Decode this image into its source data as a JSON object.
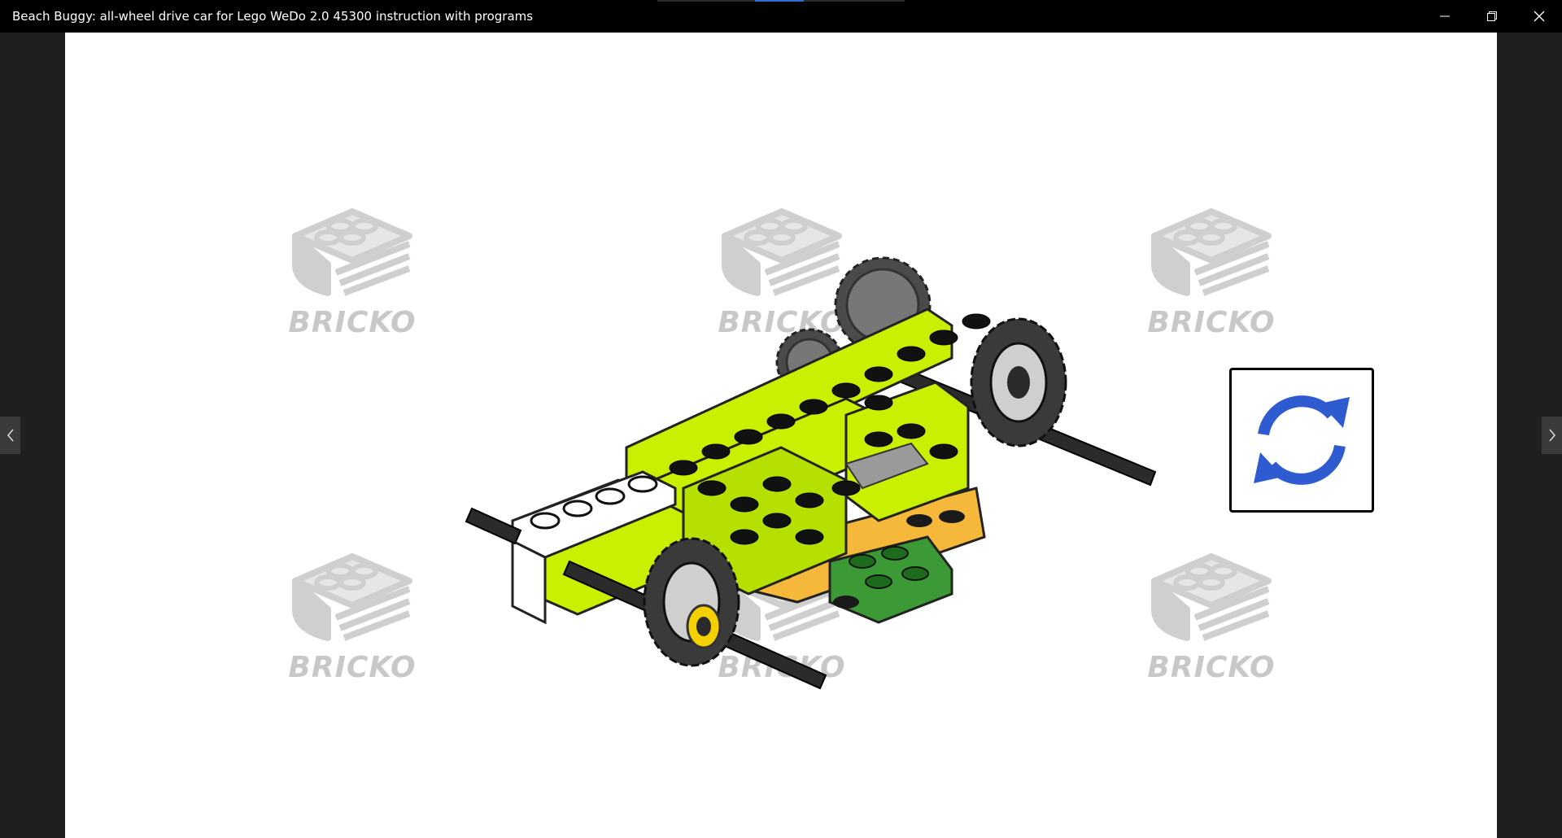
{
  "window": {
    "title": "Beach Buggy: all-wheel drive car for Lego WeDo 2.0 45300 instruction with programs",
    "controls": [
      "minimize-icon",
      "restore-icon",
      "close-icon"
    ]
  },
  "navigation": {
    "previous_icon": "chevron-left-icon",
    "next_icon": "chevron-right-icon"
  },
  "watermark": {
    "text": "BRICKO",
    "color": "#c8c8c8"
  },
  "model_image": {
    "colors": {
      "lime": "#c8f000",
      "lime_dark": "#9ec000",
      "orange": "#f5b83a",
      "green": "#3c9a36",
      "dark_gray": "#4a4a4a",
      "axle": "#2b2b2b",
      "white": "#ffffff"
    }
  },
  "rotate_button": {
    "icon": "rotate-icon",
    "color": "#2f5bd0"
  }
}
